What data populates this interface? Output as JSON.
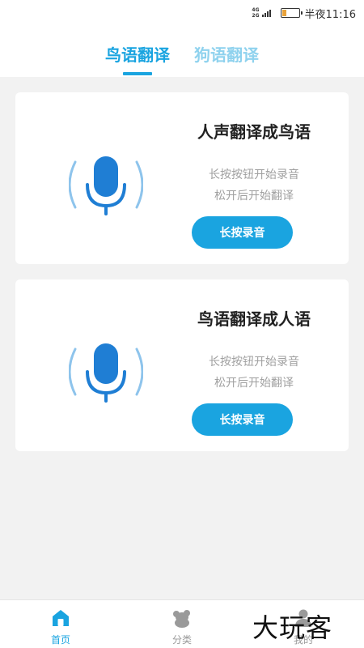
{
  "status_bar": {
    "net_top": "4G",
    "net_bottom": "2G",
    "time": "半夜11:16"
  },
  "tabs": [
    {
      "label": "鸟语翻译",
      "active": true
    },
    {
      "label": "狗语翻译",
      "active": false
    }
  ],
  "cards": [
    {
      "title": "人声翻译成鸟语",
      "hint_line1": "长按按钮开始录音",
      "hint_line2": "松开后开始翻译",
      "button_label": "长按录音"
    },
    {
      "title": "鸟语翻译成人语",
      "hint_line1": "长按按钮开始录音",
      "hint_line2": "松开后开始翻译",
      "button_label": "长按录音"
    }
  ],
  "bottom_nav": [
    {
      "label": "首页",
      "icon": "home-icon",
      "active": true
    },
    {
      "label": "分类",
      "icon": "koala-icon",
      "active": false
    },
    {
      "label": "我的",
      "icon": "user-icon",
      "active": false
    }
  ],
  "watermark": "大玩客",
  "colors": {
    "accent": "#1aa4e0",
    "tab_inactive": "#8fd2ee",
    "mic": "#1f7ed4",
    "mic_waves": "#8ec4ec",
    "background": "#f2f2f2"
  }
}
